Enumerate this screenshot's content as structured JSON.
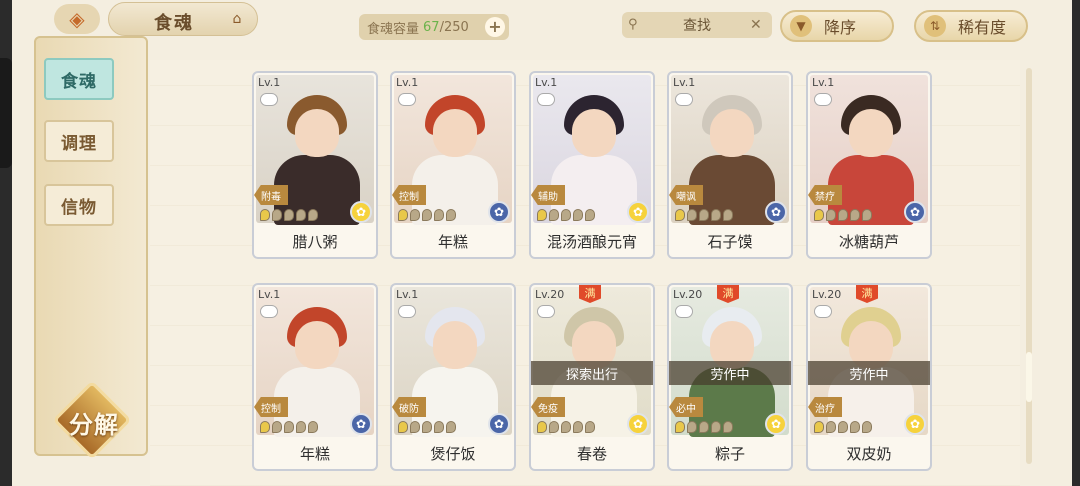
{
  "header": {
    "title": "食魂",
    "capacity_label": "食魂容量",
    "capacity_current": "67",
    "capacity_max": "/250",
    "capacity_plus": "+",
    "search_label": "查找",
    "search_clear": "✕",
    "sort_label": "降序",
    "rarity_label": "稀有度"
  },
  "sidebar": {
    "items": [
      {
        "label": "食魂",
        "active": true
      },
      {
        "label": "调理",
        "active": false
      },
      {
        "label": "信物",
        "active": false
      }
    ],
    "decompose_label": "分解"
  },
  "cards": [
    {
      "level": "Lv.1",
      "role": "附毒",
      "name": "腊八粥",
      "stars": 0,
      "medal": "gold",
      "status": "",
      "max": ""
    },
    {
      "level": "Lv.1",
      "role": "控制",
      "name": "年糕",
      "stars": 0,
      "medal": "blue",
      "status": "",
      "max": ""
    },
    {
      "level": "Lv.1",
      "role": "辅助",
      "name": "混汤酒酿元宵",
      "stars": 0,
      "medal": "gold",
      "status": "",
      "max": ""
    },
    {
      "level": "Lv.1",
      "role": "嘲讽",
      "name": "石子馍",
      "stars": 0,
      "medal": "blue",
      "status": "",
      "max": ""
    },
    {
      "level": "Lv.1",
      "role": "禁疗",
      "name": "冰糖葫芦",
      "stars": 0,
      "medal": "blue",
      "status": "",
      "max": ""
    },
    {
      "level": "Lv.1",
      "role": "控制",
      "name": "年糕",
      "stars": 0,
      "medal": "blue",
      "status": "",
      "max": ""
    },
    {
      "level": "Lv.1",
      "role": "破防",
      "name": "煲仔饭",
      "stars": 0,
      "medal": "blue",
      "status": "",
      "max": ""
    },
    {
      "level": "Lv.20",
      "role": "免疫",
      "name": "春卷",
      "stars": 0,
      "medal": "gold",
      "status": "探索出行",
      "max": "满"
    },
    {
      "level": "Lv.20",
      "role": "必中",
      "name": "粽子",
      "stars": 0,
      "medal": "gold",
      "status": "劳作中",
      "max": "满"
    },
    {
      "level": "Lv.20",
      "role": "治疗",
      "name": "双皮奶",
      "stars": 0,
      "medal": "gold",
      "status": "劳作中",
      "max": "满"
    }
  ],
  "icons": {
    "back": "back-arrow-icon",
    "tab": "hat-icon",
    "search": "search-icon",
    "sort": "down-triangle-icon",
    "rarity": "rarity-sort-icon"
  }
}
